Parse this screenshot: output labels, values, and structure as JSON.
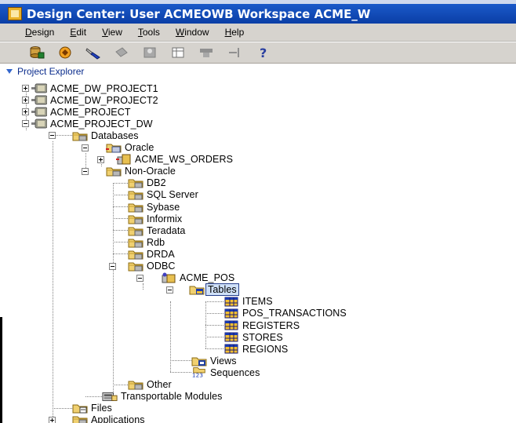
{
  "window": {
    "title": "Design Center: User ACMEOWB   Workspace ACME_W"
  },
  "menu": [
    {
      "label": "Design",
      "mnemonic": "D",
      "rest": "esign"
    },
    {
      "label": "Edit",
      "mnemonic": "E",
      "rest": "dit"
    },
    {
      "label": "View",
      "mnemonic": "V",
      "rest": "iew"
    },
    {
      "label": "Tools",
      "mnemonic": "T",
      "rest": "ools"
    },
    {
      "label": "Window",
      "mnemonic": "W",
      "rest": "indow"
    },
    {
      "label": "Help",
      "mnemonic": "H",
      "rest": "elp"
    }
  ],
  "toolbar": {
    "icons": [
      "database-add-icon",
      "deploy-icon",
      "flashlight-icon",
      "link-icon",
      "properties-icon",
      "grid-icon",
      "table-icon",
      "split-icon",
      "help-icon"
    ]
  },
  "explorer": {
    "title": "Project Explorer",
    "nodes": {
      "p1": "ACME_DW_PROJECT1",
      "p2": "ACME_DW_PROJECT2",
      "p3": "ACME_PROJECT",
      "p4": "ACME_PROJECT_DW",
      "databases": "Databases",
      "oracle": "Oracle",
      "ws_orders": "ACME_WS_ORDERS",
      "non_oracle": "Non-Oracle",
      "db2": "DB2",
      "sqlserver": "SQL Server",
      "sybase": "Sybase",
      "informix": "Informix",
      "teradata": "Teradata",
      "rdb": "Rdb",
      "drda": "DRDA",
      "odbc": "ODBC",
      "acme_pos": "ACME_POS",
      "tables": "Tables",
      "items": "ITEMS",
      "pos_tx": "POS_TRANSACTIONS",
      "registers": "REGISTERS",
      "stores": "STORES",
      "regions": "REGIONS",
      "views": "Views",
      "sequences": "Sequences",
      "other": "Other",
      "transportable": "Transportable Modules",
      "files": "Files",
      "applications": "Applications"
    }
  }
}
